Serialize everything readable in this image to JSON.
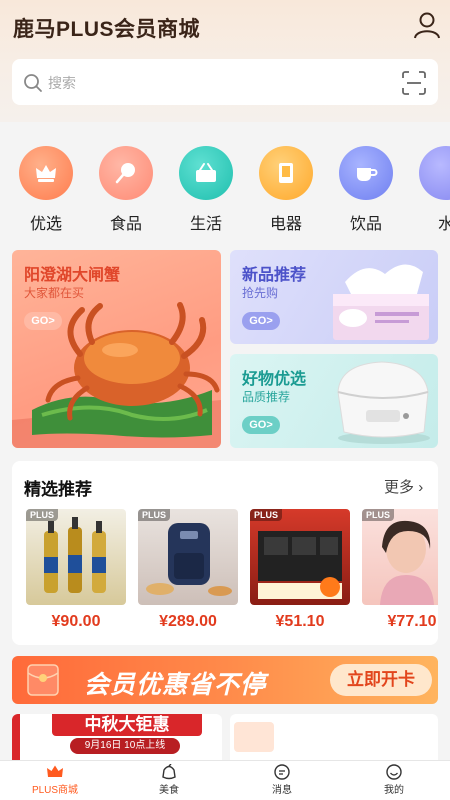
{
  "header": {
    "title": "鹿马PLUS会员商城"
  },
  "search": {
    "placeholder": "搜索"
  },
  "categories": [
    {
      "label": "优选",
      "color": "#ff8a5c"
    },
    {
      "label": "食品",
      "color": "#ff8f7a"
    },
    {
      "label": "生活",
      "color": "#27c9b8"
    },
    {
      "label": "电器",
      "color": "#ffb33c"
    },
    {
      "label": "饮品",
      "color": "#7a8cf5"
    },
    {
      "label": "水",
      "color": "#8a8cf0"
    }
  ],
  "banners": {
    "crab": {
      "title": "阳澄湖大闸蟹",
      "subtitle": "大家都在买",
      "go": "GO>"
    },
    "new": {
      "title": "新品推荐",
      "subtitle": "抢先购",
      "go": "GO>"
    },
    "good": {
      "title": "好物优选",
      "subtitle": "品质推荐",
      "go": "GO>"
    }
  },
  "recommend": {
    "title": "精选推荐",
    "more": "更多",
    "plus_tag": "PLUS",
    "products": [
      {
        "price": "¥90.00"
      },
      {
        "price": "¥289.00"
      },
      {
        "price": "¥51.10"
      },
      {
        "price": "¥77.10"
      }
    ]
  },
  "member": {
    "slogan": "会员优惠省不停",
    "button": "立即开卡"
  },
  "promo": {
    "left_title": "中秋大钜惠",
    "left_sub": "9月16日 10点上线"
  },
  "tabbar": {
    "items": [
      {
        "label": "PLUS商城",
        "icon": "crown-icon",
        "active": true
      },
      {
        "label": "美食",
        "icon": "food-icon",
        "active": false
      },
      {
        "label": "消息",
        "icon": "message-icon",
        "active": false
      },
      {
        "label": "我的",
        "icon": "smile-icon",
        "active": false
      }
    ],
    "active_color": "#ff5a1f"
  }
}
